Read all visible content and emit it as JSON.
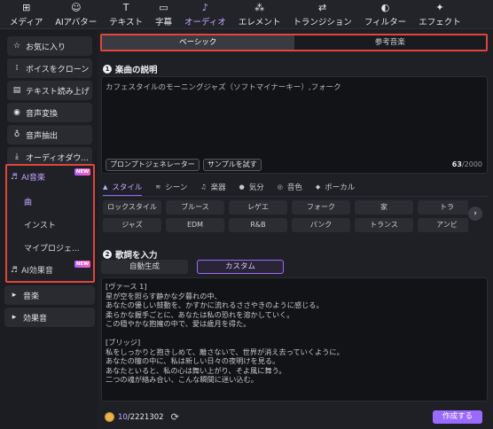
{
  "toolbar": {
    "items": [
      {
        "label": "メディア",
        "icon": "media-icon",
        "glyph": "⊞"
      },
      {
        "label": "AIアバター",
        "icon": "ai-avatar-icon",
        "glyph": "☺"
      },
      {
        "label": "テキスト",
        "icon": "text-icon",
        "glyph": "T"
      },
      {
        "label": "字幕",
        "icon": "subtitle-icon",
        "glyph": "▭"
      },
      {
        "label": "オーディオ",
        "icon": "audio-icon",
        "glyph": "♪"
      },
      {
        "label": "エレメント",
        "icon": "element-icon",
        "glyph": "⁂"
      },
      {
        "label": "トランジション",
        "icon": "transition-icon",
        "glyph": "⇄"
      },
      {
        "label": "フィルター",
        "icon": "filter-icon",
        "glyph": "◐"
      },
      {
        "label": "エフェクト",
        "icon": "effect-icon",
        "glyph": "✦"
      }
    ]
  },
  "sidebar": {
    "items_top": [
      {
        "label": "お気に入り",
        "icon": "star-icon",
        "glyph": "☆"
      },
      {
        "label": "ボイスをクローン",
        "icon": "voice-clone-icon",
        "glyph": "⁞"
      },
      {
        "label": "テキスト読み上げ",
        "icon": "tts-icon",
        "glyph": "▤"
      },
      {
        "label": "音声変換",
        "icon": "voice-change-icon",
        "glyph": "◉"
      },
      {
        "label": "音声抽出",
        "icon": "mic-icon",
        "glyph": "♁"
      },
      {
        "label": "オーディオダウ...",
        "icon": "download-icon",
        "glyph": "⤓"
      }
    ],
    "ai_music": {
      "label": "AI音楽",
      "badge": "NEW",
      "glyph": "♬"
    },
    "ai_sub": [
      {
        "label": "曲"
      },
      {
        "label": "インスト"
      },
      {
        "label": "マイプロジェ..."
      }
    ],
    "ai_sfx": {
      "label": "AI効果音",
      "badge": "NEW",
      "glyph": "♬"
    },
    "items_bottom": [
      {
        "label": "音楽",
        "glyph": "▸"
      },
      {
        "label": "効果音",
        "glyph": "▸"
      }
    ]
  },
  "main": {
    "mode_tabs": [
      "ベーシック",
      "参考音楽"
    ],
    "section1": {
      "num": "1",
      "title": "楽曲の説明"
    },
    "description": "カフェスタイルのモーニングジャズ（ソフトマイナーキー）,フォーク",
    "prompt_button": "プロンプトジェネレーター",
    "sample_button": "サンプルを試す",
    "counter_used": "63",
    "counter_total": "/2000",
    "categories": [
      {
        "label": "スタイル",
        "glyph": "▲"
      },
      {
        "label": "シーン",
        "glyph": "≋"
      },
      {
        "label": "楽器",
        "glyph": "♫"
      },
      {
        "label": "気分",
        "glyph": "●"
      },
      {
        "label": "音色",
        "glyph": "◎"
      },
      {
        "label": "ボーカル",
        "glyph": "◆"
      }
    ],
    "chips_row1": [
      "ロックスタイル",
      "ブルース",
      "レゲエ",
      "フォーク",
      "家",
      "トラ"
    ],
    "chips_row2": [
      "ジャズ",
      "EDM",
      "R&B",
      "パンク",
      "トランス",
      "アンビ"
    ],
    "section2": {
      "num": "2",
      "title": "歌詞を入力"
    },
    "lyrics_tabs": [
      "自動生成",
      "カスタム"
    ],
    "lyrics": [
      "[ヴァース 1]",
      "星が空を照らす静かな夕暮れの中、",
      "あなたの優しい鼓動を、かすかに流れるささやきのように感じる。",
      "柔らかな握手ごとに、あなたは私の恐れを溶かしていく。",
      "この穏やかな抱擁の中で、愛は歳月を得た。",
      "",
      "[ブリッジ]",
      "私をしっかりと抱きしめて、離さないで、世界が消え去っていくように。",
      "あなたの瞳の中に、私は新しい日々の夜明けを見る。",
      "あなたといると、私の心は舞い上がり、そよ風に舞う。",
      "二つの魂が絡み合い、こんな瞬間に迷い込む。"
    ],
    "credit_used": "10",
    "credit_total": "/2221302",
    "create_button": "作成する"
  },
  "colors": {
    "accent": "#9b6bff",
    "highlight_border": "#e0463a",
    "background": "#1f2026"
  }
}
